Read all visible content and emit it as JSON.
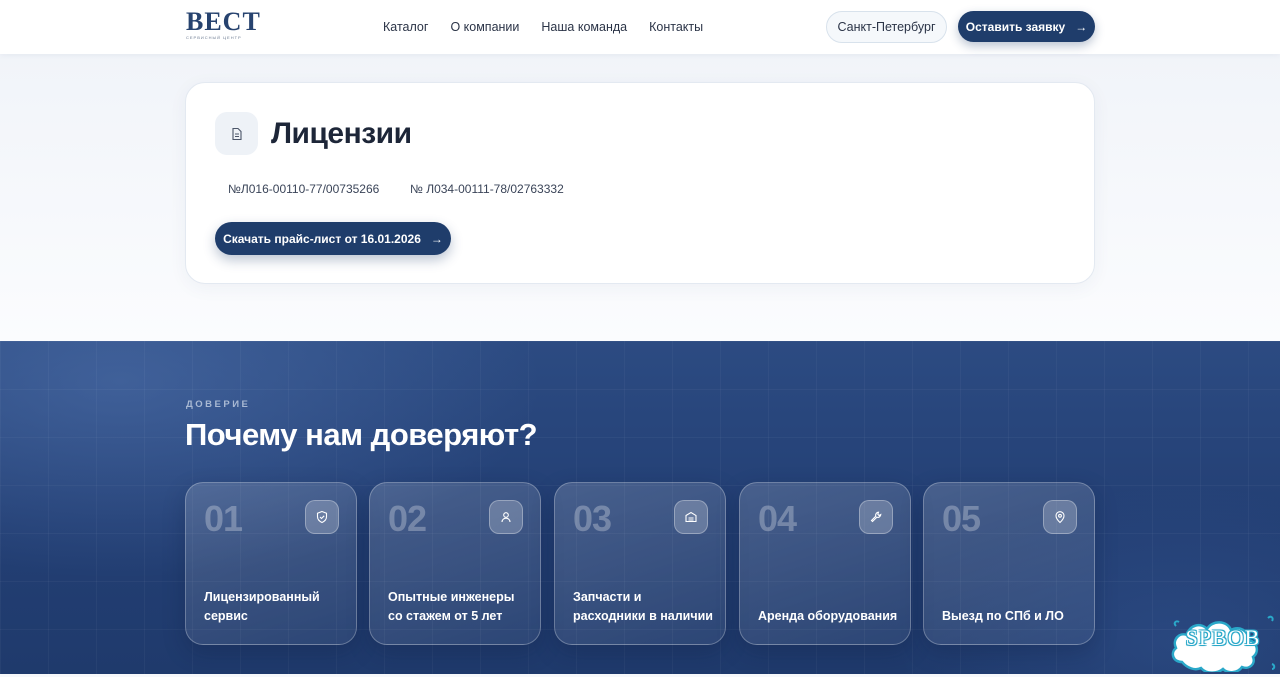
{
  "header": {
    "logo": {
      "main": "BECT",
      "sub": "сервисный центр"
    },
    "nav": [
      {
        "label": "Каталог"
      },
      {
        "label": "О компании"
      },
      {
        "label": "Наша команда"
      },
      {
        "label": "Контакты"
      }
    ],
    "city": "Санкт-Петербург",
    "cta": "Оставить заявку"
  },
  "licenses": {
    "icon": "document-icon",
    "title": "Лицензии",
    "numbers": [
      "№Л016-00110-77/00735266",
      "№ Л034-00111-78/02763332"
    ],
    "download_label": "Скачать прайс-лист от 16.01.2026"
  },
  "trust": {
    "eyebrow": "ДОВЕРИЕ",
    "title": "Почему нам доверяют?",
    "cards": [
      {
        "num": "01",
        "icon": "shield-icon",
        "text": "Лицензированный сервис"
      },
      {
        "num": "02",
        "icon": "user-icon",
        "text": "Опытные инженеры со стажем от 5 лет"
      },
      {
        "num": "03",
        "icon": "box-icon",
        "text": "Запчасти и расходники в наличии"
      },
      {
        "num": "04",
        "icon": "wrench-icon",
        "text": "Аренда оборудования"
      },
      {
        "num": "05",
        "icon": "location-icon",
        "text": "Выезд по СПб и ЛО"
      }
    ]
  },
  "badge": {
    "text": "SPBOB"
  },
  "colors": {
    "primary": "#1f3d6b",
    "section_bg": "#233f74",
    "page_bg": "#f6f8fb"
  }
}
